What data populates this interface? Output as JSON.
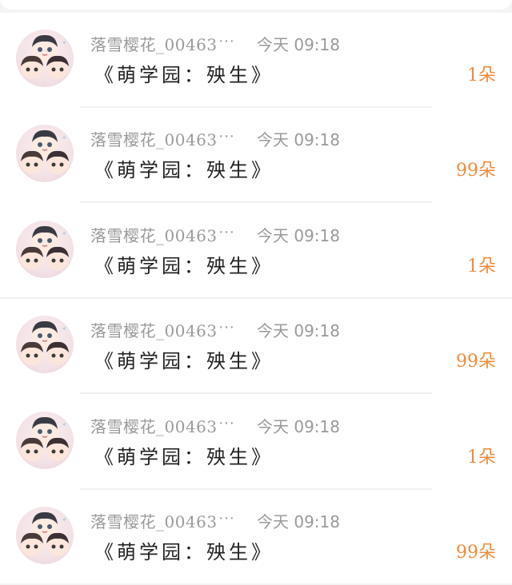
{
  "messages": [
    {
      "username": "落雪樱花_00463",
      "more": "···",
      "time": "今天 09:18",
      "title": "《萌学园：殃生》",
      "count": "1朵"
    },
    {
      "username": "落雪樱花_00463",
      "more": "···",
      "time": "今天 09:18",
      "title": "《萌学园：殃生》",
      "count": "99朵"
    },
    {
      "username": "落雪樱花_00463",
      "more": "···",
      "time": "今天 09:18",
      "title": "《萌学园：殃生》",
      "count": "1朵"
    },
    {
      "username": "落雪樱花_00463",
      "more": "···",
      "time": "今天 09:18",
      "title": "《萌学园：殃生》",
      "count": "99朵"
    },
    {
      "username": "落雪樱花_00463",
      "more": "···",
      "time": "今天 09:18",
      "title": "《萌学园：殃生》",
      "count": "1朵"
    },
    {
      "username": "落雪樱花_00463",
      "more": "···",
      "time": "今天 09:18",
      "title": "《萌学园：殃生》",
      "count": "99朵"
    }
  ],
  "colors": {
    "count": "#f08b3b",
    "meta": "#9a9a9a",
    "title": "#222222"
  },
  "icons": {
    "avatar": "anime-trio-avatar"
  }
}
